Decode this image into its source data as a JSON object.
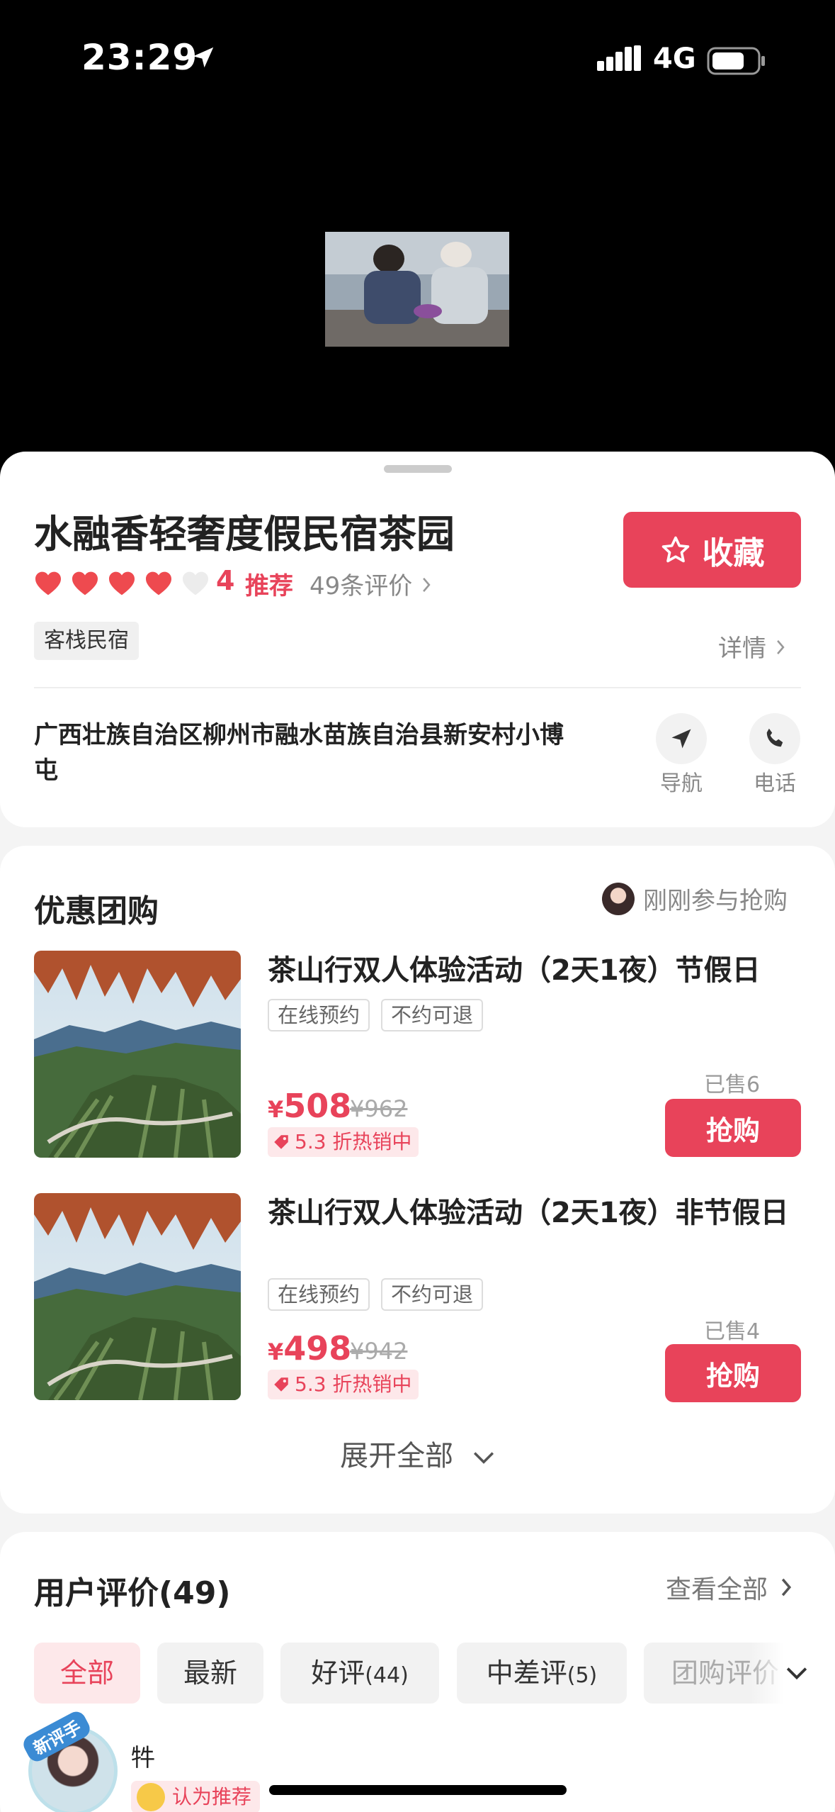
{
  "status_bar": {
    "time": "23:29",
    "network": "4G"
  },
  "shop": {
    "name": "水融香轻奢度假民宿茶园",
    "favorite_label": "收藏",
    "rating_score": "4",
    "rating_text": "推荐",
    "review_count_text": "49条评价",
    "category_tag": "客栈民宿",
    "detail_link": "详情",
    "address": "广西壮族自治区柳州市融水苗族自治县新安村小博屯",
    "nav_label": "导航",
    "phone_label": "电话",
    "hearts_filled": 4,
    "hearts_total": 5
  },
  "group_buy": {
    "title": "优惠团购",
    "recent_buyer_text": "刚刚参与抢购",
    "deals": [
      {
        "title": "茶山行双人体验活动（2天1夜）节假日",
        "tags": [
          "在线预约",
          "不约可退"
        ],
        "currency": "¥",
        "price": "508",
        "original_price": "¥962",
        "discount": "5.3 折热销中",
        "sold": "已售6",
        "buy_label": "抢购"
      },
      {
        "title": "茶山行双人体验活动（2天1夜）非节假日",
        "tags": [
          "在线预约",
          "不约可退"
        ],
        "currency": "¥",
        "price": "498",
        "original_price": "¥942",
        "discount": "5.3 折热销中",
        "sold": "已售4",
        "buy_label": "抢购"
      }
    ],
    "expand_label": "展开全部"
  },
  "reviews": {
    "title": "用户评价(49)",
    "see_all": "查看全部",
    "filters": [
      {
        "label": "全部",
        "count": ""
      },
      {
        "label": "最新",
        "count": ""
      },
      {
        "label": "好评",
        "count": "(44)"
      },
      {
        "label": "中差评",
        "count": "(5)"
      },
      {
        "label": "团购评价",
        "count": ""
      }
    ],
    "first_review": {
      "badge": "新评手",
      "user": "牪",
      "recommend": "认为推荐"
    }
  },
  "colors": {
    "accent": "#e8435a",
    "accent_light": "#fde8ea"
  }
}
